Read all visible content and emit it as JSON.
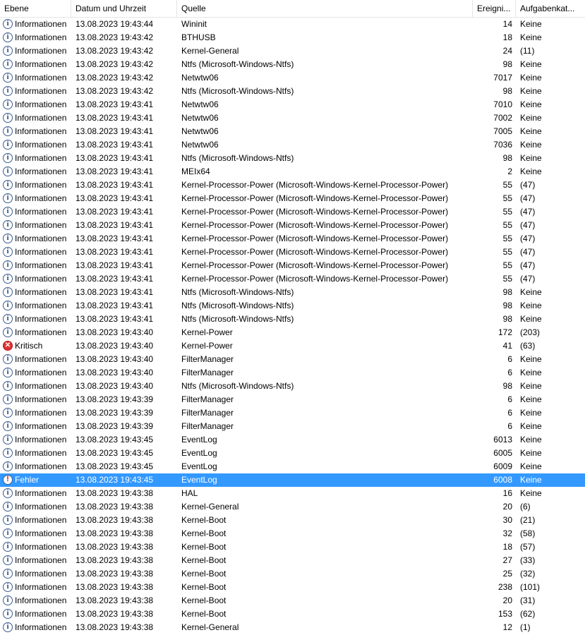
{
  "columns": {
    "level": "Ebene",
    "datetime": "Datum und Uhrzeit",
    "source": "Quelle",
    "event_id": "Ereigni...",
    "task_category": "Aufgabenkat..."
  },
  "icons": {
    "info": "information-icon",
    "critical": "critical-icon",
    "error": "error-icon"
  },
  "colors": {
    "selection": "#3399ff",
    "info_icon": "#3b5b8c",
    "critical_icon": "#e23232"
  },
  "rows": [
    {
      "level": "Informationen",
      "icon": "info",
      "datetime": "13.08.2023 19:43:44",
      "source": "Wininit",
      "event_id": "14",
      "task": "Keine"
    },
    {
      "level": "Informationen",
      "icon": "info",
      "datetime": "13.08.2023 19:43:42",
      "source": "BTHUSB",
      "event_id": "18",
      "task": "Keine"
    },
    {
      "level": "Informationen",
      "icon": "info",
      "datetime": "13.08.2023 19:43:42",
      "source": "Kernel-General",
      "event_id": "24",
      "task": "(11)"
    },
    {
      "level": "Informationen",
      "icon": "info",
      "datetime": "13.08.2023 19:43:42",
      "source": "Ntfs (Microsoft-Windows-Ntfs)",
      "event_id": "98",
      "task": "Keine"
    },
    {
      "level": "Informationen",
      "icon": "info",
      "datetime": "13.08.2023 19:43:42",
      "source": "Netwtw06",
      "event_id": "7017",
      "task": "Keine"
    },
    {
      "level": "Informationen",
      "icon": "info",
      "datetime": "13.08.2023 19:43:42",
      "source": "Ntfs (Microsoft-Windows-Ntfs)",
      "event_id": "98",
      "task": "Keine"
    },
    {
      "level": "Informationen",
      "icon": "info",
      "datetime": "13.08.2023 19:43:41",
      "source": "Netwtw06",
      "event_id": "7010",
      "task": "Keine"
    },
    {
      "level": "Informationen",
      "icon": "info",
      "datetime": "13.08.2023 19:43:41",
      "source": "Netwtw06",
      "event_id": "7002",
      "task": "Keine"
    },
    {
      "level": "Informationen",
      "icon": "info",
      "datetime": "13.08.2023 19:43:41",
      "source": "Netwtw06",
      "event_id": "7005",
      "task": "Keine"
    },
    {
      "level": "Informationen",
      "icon": "info",
      "datetime": "13.08.2023 19:43:41",
      "source": "Netwtw06",
      "event_id": "7036",
      "task": "Keine"
    },
    {
      "level": "Informationen",
      "icon": "info",
      "datetime": "13.08.2023 19:43:41",
      "source": "Ntfs (Microsoft-Windows-Ntfs)",
      "event_id": "98",
      "task": "Keine"
    },
    {
      "level": "Informationen",
      "icon": "info",
      "datetime": "13.08.2023 19:43:41",
      "source": "MEIx64",
      "event_id": "2",
      "task": "Keine"
    },
    {
      "level": "Informationen",
      "icon": "info",
      "datetime": "13.08.2023 19:43:41",
      "source": "Kernel-Processor-Power (Microsoft-Windows-Kernel-Processor-Power)",
      "event_id": "55",
      "task": "(47)"
    },
    {
      "level": "Informationen",
      "icon": "info",
      "datetime": "13.08.2023 19:43:41",
      "source": "Kernel-Processor-Power (Microsoft-Windows-Kernel-Processor-Power)",
      "event_id": "55",
      "task": "(47)"
    },
    {
      "level": "Informationen",
      "icon": "info",
      "datetime": "13.08.2023 19:43:41",
      "source": "Kernel-Processor-Power (Microsoft-Windows-Kernel-Processor-Power)",
      "event_id": "55",
      "task": "(47)"
    },
    {
      "level": "Informationen",
      "icon": "info",
      "datetime": "13.08.2023 19:43:41",
      "source": "Kernel-Processor-Power (Microsoft-Windows-Kernel-Processor-Power)",
      "event_id": "55",
      "task": "(47)"
    },
    {
      "level": "Informationen",
      "icon": "info",
      "datetime": "13.08.2023 19:43:41",
      "source": "Kernel-Processor-Power (Microsoft-Windows-Kernel-Processor-Power)",
      "event_id": "55",
      "task": "(47)"
    },
    {
      "level": "Informationen",
      "icon": "info",
      "datetime": "13.08.2023 19:43:41",
      "source": "Kernel-Processor-Power (Microsoft-Windows-Kernel-Processor-Power)",
      "event_id": "55",
      "task": "(47)"
    },
    {
      "level": "Informationen",
      "icon": "info",
      "datetime": "13.08.2023 19:43:41",
      "source": "Kernel-Processor-Power (Microsoft-Windows-Kernel-Processor-Power)",
      "event_id": "55",
      "task": "(47)"
    },
    {
      "level": "Informationen",
      "icon": "info",
      "datetime": "13.08.2023 19:43:41",
      "source": "Kernel-Processor-Power (Microsoft-Windows-Kernel-Processor-Power)",
      "event_id": "55",
      "task": "(47)"
    },
    {
      "level": "Informationen",
      "icon": "info",
      "datetime": "13.08.2023 19:43:41",
      "source": "Ntfs (Microsoft-Windows-Ntfs)",
      "event_id": "98",
      "task": "Keine"
    },
    {
      "level": "Informationen",
      "icon": "info",
      "datetime": "13.08.2023 19:43:41",
      "source": "Ntfs (Microsoft-Windows-Ntfs)",
      "event_id": "98",
      "task": "Keine"
    },
    {
      "level": "Informationen",
      "icon": "info",
      "datetime": "13.08.2023 19:43:41",
      "source": "Ntfs (Microsoft-Windows-Ntfs)",
      "event_id": "98",
      "task": "Keine"
    },
    {
      "level": "Informationen",
      "icon": "info",
      "datetime": "13.08.2023 19:43:40",
      "source": "Kernel-Power",
      "event_id": "172",
      "task": "(203)"
    },
    {
      "level": "Kritisch",
      "icon": "critical",
      "datetime": "13.08.2023 19:43:40",
      "source": "Kernel-Power",
      "event_id": "41",
      "task": "(63)"
    },
    {
      "level": "Informationen",
      "icon": "info",
      "datetime": "13.08.2023 19:43:40",
      "source": "FilterManager",
      "event_id": "6",
      "task": "Keine"
    },
    {
      "level": "Informationen",
      "icon": "info",
      "datetime": "13.08.2023 19:43:40",
      "source": "FilterManager",
      "event_id": "6",
      "task": "Keine"
    },
    {
      "level": "Informationen",
      "icon": "info",
      "datetime": "13.08.2023 19:43:40",
      "source": "Ntfs (Microsoft-Windows-Ntfs)",
      "event_id": "98",
      "task": "Keine"
    },
    {
      "level": "Informationen",
      "icon": "info",
      "datetime": "13.08.2023 19:43:39",
      "source": "FilterManager",
      "event_id": "6",
      "task": "Keine"
    },
    {
      "level": "Informationen",
      "icon": "info",
      "datetime": "13.08.2023 19:43:39",
      "source": "FilterManager",
      "event_id": "6",
      "task": "Keine"
    },
    {
      "level": "Informationen",
      "icon": "info",
      "datetime": "13.08.2023 19:43:39",
      "source": "FilterManager",
      "event_id": "6",
      "task": "Keine"
    },
    {
      "level": "Informationen",
      "icon": "info",
      "datetime": "13.08.2023 19:43:45",
      "source": "EventLog",
      "event_id": "6013",
      "task": "Keine"
    },
    {
      "level": "Informationen",
      "icon": "info",
      "datetime": "13.08.2023 19:43:45",
      "source": "EventLog",
      "event_id": "6005",
      "task": "Keine"
    },
    {
      "level": "Informationen",
      "icon": "info",
      "datetime": "13.08.2023 19:43:45",
      "source": "EventLog",
      "event_id": "6009",
      "task": "Keine"
    },
    {
      "level": "Fehler",
      "icon": "error",
      "datetime": "13.08.2023 19:43:45",
      "source": "EventLog",
      "event_id": "6008",
      "task": "Keine",
      "selected": true
    },
    {
      "level": "Informationen",
      "icon": "info",
      "datetime": "13.08.2023 19:43:38",
      "source": "HAL",
      "event_id": "16",
      "task": "Keine"
    },
    {
      "level": "Informationen",
      "icon": "info",
      "datetime": "13.08.2023 19:43:38",
      "source": "Kernel-General",
      "event_id": "20",
      "task": "(6)"
    },
    {
      "level": "Informationen",
      "icon": "info",
      "datetime": "13.08.2023 19:43:38",
      "source": "Kernel-Boot",
      "event_id": "30",
      "task": "(21)"
    },
    {
      "level": "Informationen",
      "icon": "info",
      "datetime": "13.08.2023 19:43:38",
      "source": "Kernel-Boot",
      "event_id": "32",
      "task": "(58)"
    },
    {
      "level": "Informationen",
      "icon": "info",
      "datetime": "13.08.2023 19:43:38",
      "source": "Kernel-Boot",
      "event_id": "18",
      "task": "(57)"
    },
    {
      "level": "Informationen",
      "icon": "info",
      "datetime": "13.08.2023 19:43:38",
      "source": "Kernel-Boot",
      "event_id": "27",
      "task": "(33)"
    },
    {
      "level": "Informationen",
      "icon": "info",
      "datetime": "13.08.2023 19:43:38",
      "source": "Kernel-Boot",
      "event_id": "25",
      "task": "(32)"
    },
    {
      "level": "Informationen",
      "icon": "info",
      "datetime": "13.08.2023 19:43:38",
      "source": "Kernel-Boot",
      "event_id": "238",
      "task": "(101)"
    },
    {
      "level": "Informationen",
      "icon": "info",
      "datetime": "13.08.2023 19:43:38",
      "source": "Kernel-Boot",
      "event_id": "20",
      "task": "(31)"
    },
    {
      "level": "Informationen",
      "icon": "info",
      "datetime": "13.08.2023 19:43:38",
      "source": "Kernel-Boot",
      "event_id": "153",
      "task": "(62)"
    },
    {
      "level": "Informationen",
      "icon": "info",
      "datetime": "13.08.2023 19:43:38",
      "source": "Kernel-General",
      "event_id": "12",
      "task": "(1)"
    }
  ]
}
